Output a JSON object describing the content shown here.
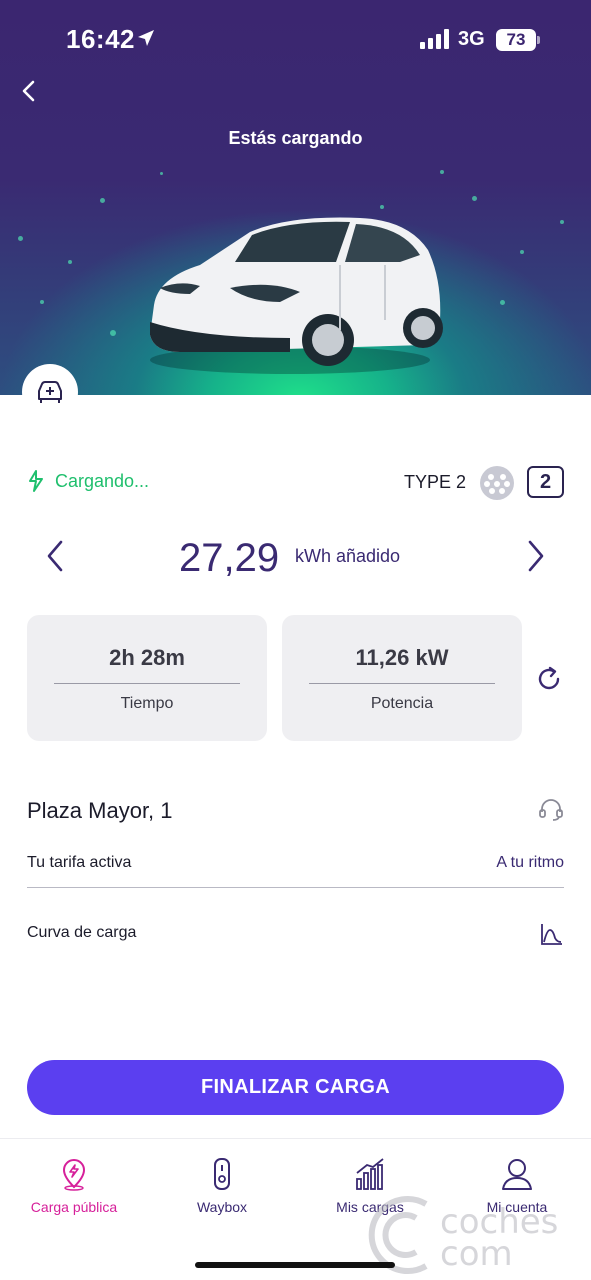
{
  "status_bar": {
    "time": "16:42",
    "network": "3G",
    "battery": "73"
  },
  "header": {
    "title": "Estás cargando"
  },
  "charging": {
    "status": "Cargando...",
    "connector_type": "TYPE 2",
    "connector_number": "2"
  },
  "energy": {
    "value": "27,29",
    "unit": "kWh  añadido"
  },
  "stats": [
    {
      "value": "2h 28m",
      "label": "Tiempo"
    },
    {
      "value": "11,26 kW",
      "label": "Potencia"
    }
  ],
  "location": {
    "title": "Plaza Mayor, 1"
  },
  "details": {
    "tariff_label": "Tu tarifa activa",
    "tariff_value": "A tu ritmo",
    "curve_label": "Curva de carga"
  },
  "actions": {
    "finish": "FINALIZAR CARGA"
  },
  "tabbar": [
    {
      "label": "Carga pública",
      "icon": "map-pin-icon",
      "active": true
    },
    {
      "label": "Waybox",
      "icon": "charger-icon",
      "active": false
    },
    {
      "label": "Mis cargas",
      "icon": "bar-chart-icon",
      "active": false
    },
    {
      "label": "Mi cuenta",
      "icon": "user-icon",
      "active": false
    }
  ],
  "watermark": {
    "line1": "coches",
    "line2": "com"
  },
  "colors": {
    "primary": "#5b3ff0",
    "hero_top": "#3b2670",
    "hero_glow": "#1fe08a",
    "charging_green": "#1fbf6d",
    "active_tab": "#d6209a",
    "text_purple": "#3a2a72"
  }
}
